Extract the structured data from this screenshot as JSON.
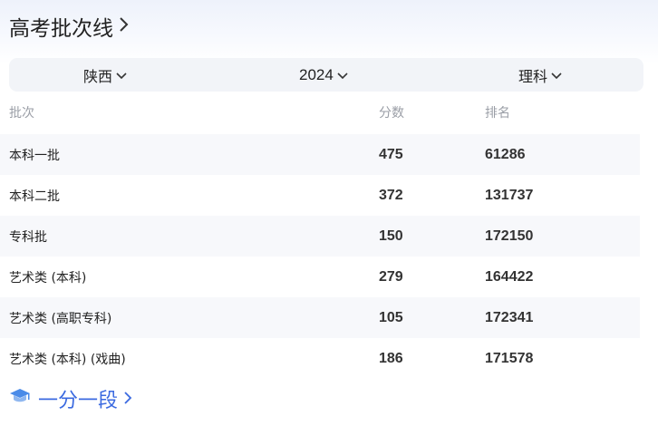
{
  "title": "高考批次线",
  "filters": {
    "province": "陕西",
    "year": "2024",
    "subject": "理科"
  },
  "columns": [
    "批次",
    "分数",
    "排名"
  ],
  "rows": [
    {
      "batch": "本科一批",
      "score": "475",
      "rank": "61286"
    },
    {
      "batch": "本科二批",
      "score": "372",
      "rank": "131737"
    },
    {
      "batch": "专科批",
      "score": "150",
      "rank": "172150"
    },
    {
      "batch": "艺术类 (本科)",
      "score": "279",
      "rank": "164422"
    },
    {
      "batch": "艺术类 (高职专科)",
      "score": "105",
      "rank": "172341"
    },
    {
      "batch": "艺术类 (本科) (戏曲)",
      "score": "186",
      "rank": "171578"
    }
  ],
  "footer": {
    "link_label": "一分一段",
    "icon": "graduation-cap-icon"
  },
  "colors": {
    "accent": "#3b6ae0",
    "filter_bg": "#f2f4f8",
    "row_shade": "#f7f8fb",
    "muted": "#9a9ea6"
  }
}
